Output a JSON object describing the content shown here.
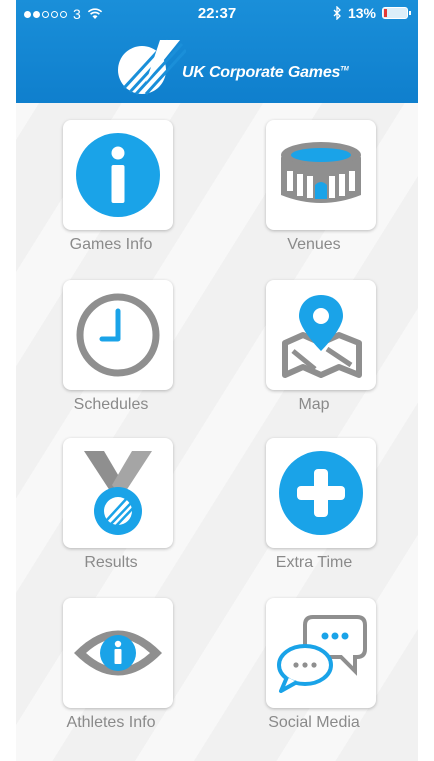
{
  "status_bar": {
    "carrier": "3",
    "time": "22:37",
    "battery": "13%",
    "signal_bars_filled": 2,
    "signal_bars_total": 5
  },
  "header": {
    "logo_text": "UK Corporate Games",
    "trademark": "TM",
    "background_color": "#1a8fd9"
  },
  "menu": [
    {
      "id": "games-info",
      "label": "Games Info",
      "icon": "info-icon"
    },
    {
      "id": "venues",
      "label": "Venues",
      "icon": "stadium-icon"
    },
    {
      "id": "schedules",
      "label": "Schedules",
      "icon": "clock-icon"
    },
    {
      "id": "map",
      "label": "Map",
      "icon": "map-pin-icon"
    },
    {
      "id": "results",
      "label": "Results",
      "icon": "medal-icon"
    },
    {
      "id": "extra-time",
      "label": "Extra Time",
      "icon": "plus-icon"
    },
    {
      "id": "athletes-info",
      "label": "Athletes Info",
      "icon": "eye-info-icon"
    },
    {
      "id": "social-media",
      "label": "Social Media",
      "icon": "chat-bubbles-icon"
    }
  ],
  "colors": {
    "accent_blue": "#1aa3e8",
    "icon_gray": "#8f8f8f",
    "label_gray": "#8a8a8a"
  }
}
